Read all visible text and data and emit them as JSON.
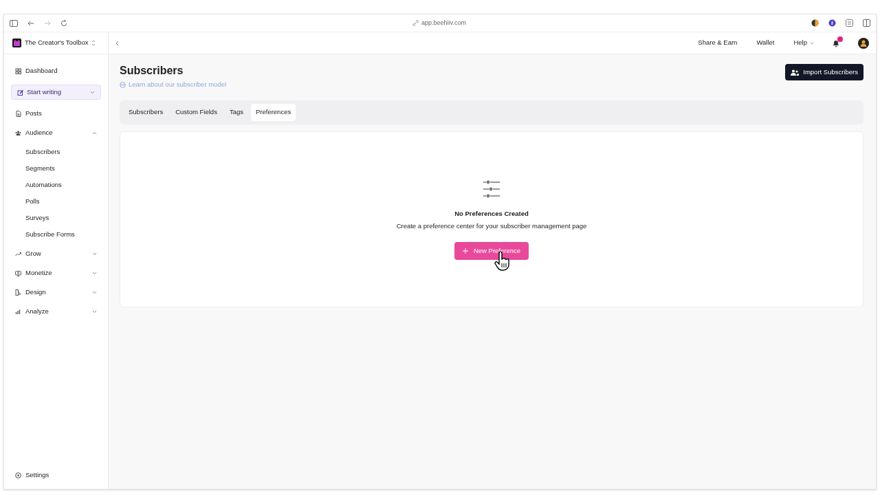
{
  "browser": {
    "url": "app.beehiiv.com"
  },
  "workspace": {
    "name": "The Creator's Toolbox"
  },
  "sidebar": {
    "items": [
      {
        "kind": "link",
        "label": "Dashboard"
      },
      {
        "kind": "button",
        "label": "Start writing"
      },
      {
        "kind": "link",
        "label": "Posts"
      },
      {
        "kind": "group",
        "label": "Audience",
        "expanded": true,
        "children": [
          {
            "label": "Subscribers"
          },
          {
            "label": "Segments"
          },
          {
            "label": "Automations"
          },
          {
            "label": "Polls"
          },
          {
            "label": "Surveys"
          },
          {
            "label": "Subscribe Forms"
          }
        ]
      },
      {
        "kind": "group",
        "label": "Grow",
        "expanded": false
      },
      {
        "kind": "group",
        "label": "Monetize",
        "expanded": false
      },
      {
        "kind": "group",
        "label": "Design",
        "expanded": false
      },
      {
        "kind": "group",
        "label": "Analyze",
        "expanded": false
      }
    ],
    "footer": {
      "label": "Settings"
    }
  },
  "header": {
    "links": [
      {
        "label": "Share & Earn",
        "dropdown": false
      },
      {
        "label": "Wallet",
        "dropdown": false
      },
      {
        "label": "Help",
        "dropdown": true
      }
    ],
    "notifications_unread": true
  },
  "page": {
    "title": "Subscribers",
    "help_link": "Learn about our subscriber model",
    "action": "Import Subscribers",
    "tabs": [
      {
        "label": "Subscribers",
        "selected": false
      },
      {
        "label": "Custom Fields",
        "selected": false
      },
      {
        "label": "Tags",
        "selected": false
      },
      {
        "label": "Preferences",
        "selected": true
      }
    ],
    "empty_state": {
      "title": "No Preferences Created",
      "text": "Create a preference center for your subscriber management page",
      "button": "New Preference"
    }
  }
}
